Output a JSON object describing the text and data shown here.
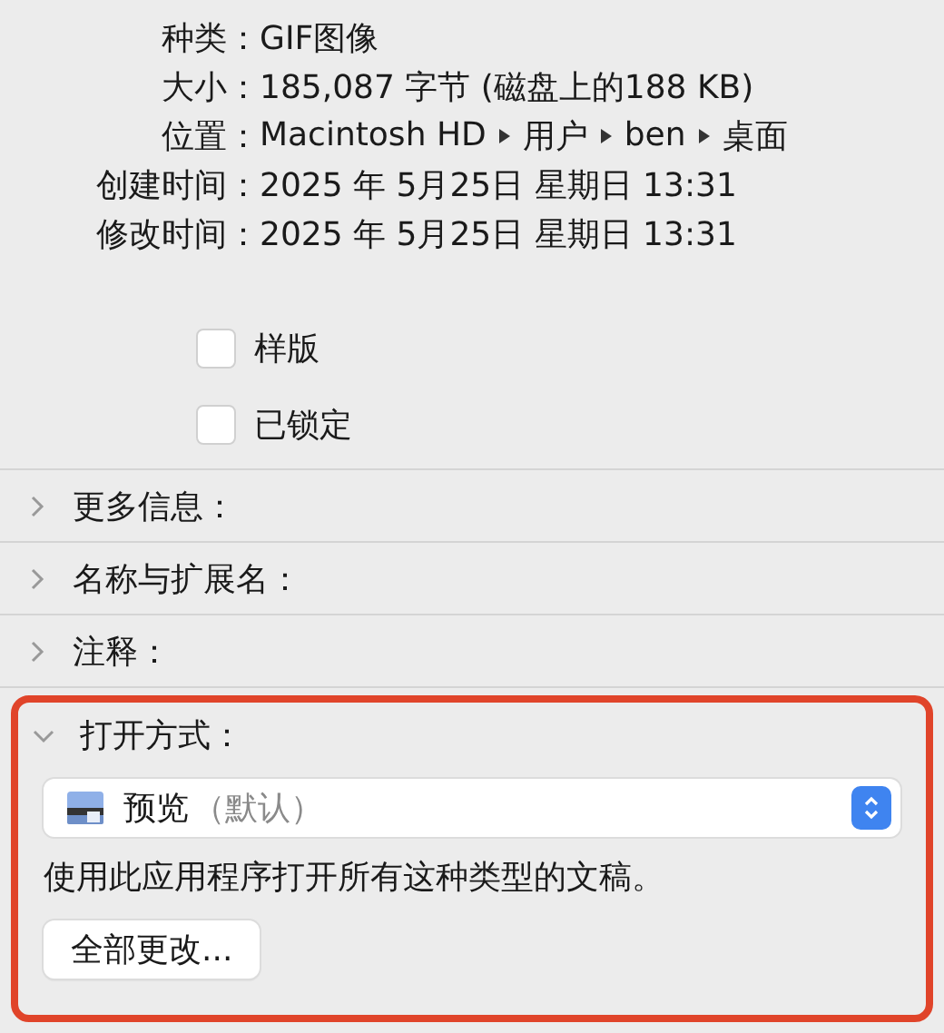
{
  "info": [
    {
      "kind": "text",
      "label": "种类：",
      "value": "GIF图像"
    },
    {
      "kind": "text",
      "label": "大小：",
      "value": "185,087 字节 (磁盘上的188 KB)"
    },
    {
      "kind": "path",
      "label": "位置：",
      "parts": [
        "Macintosh HD",
        "用户",
        "ben",
        "桌面"
      ]
    },
    {
      "kind": "text",
      "label": "创建时间：",
      "value": "2025 年 5月25日 星期日 13:31"
    },
    {
      "kind": "text",
      "label": "修改时间：",
      "value": "2025 年 5月25日 星期日 13:31"
    }
  ],
  "checkboxes": [
    {
      "label": "样版",
      "checked": false
    },
    {
      "label": "已锁定",
      "checked": false
    }
  ],
  "sections": [
    {
      "title": "更多信息：",
      "expanded": false,
      "highlighted": false
    },
    {
      "title": "名称与扩展名：",
      "expanded": false,
      "highlighted": false
    },
    {
      "title": "注释：",
      "expanded": false,
      "highlighted": false
    },
    {
      "title": "打开方式：",
      "expanded": true,
      "highlighted": true,
      "app": "预览",
      "app_note": "（默认）",
      "description": "使用此应用程序打开所有这种类型的文稿。",
      "button": "全部更改..."
    }
  ]
}
